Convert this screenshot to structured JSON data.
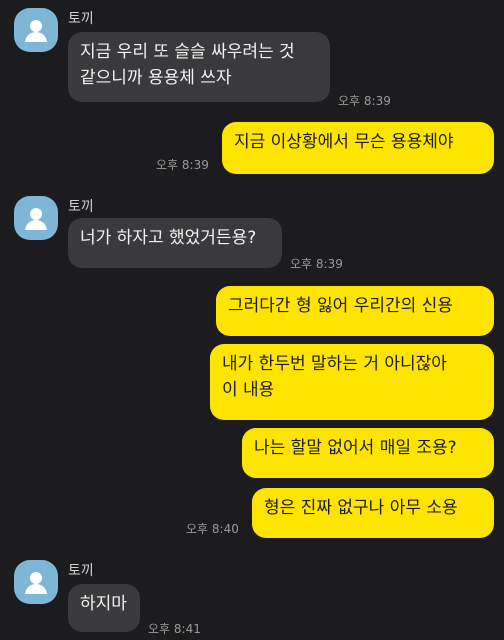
{
  "messages": [
    {
      "sender": "토끼",
      "text": "지금 우리 또 슬슬 싸우려는 것\n같으니까 용용체 쓰자",
      "time": "오후 8:39"
    },
    {
      "text": "지금 이상황에서 무슨 용용체야",
      "time": "오후 8:39"
    },
    {
      "sender": "토끼",
      "text": "너가 하자고 했었거든용?",
      "time": "오후 8:39"
    },
    {
      "text": "그러다간 형 잃어 우리간의 신용"
    },
    {
      "text": "내가 한두번 말하는 거 아니잖아\n이 내용"
    },
    {
      "text": "나는 할말 없어서 매일 조용?"
    },
    {
      "text": "형은 진짜 없구나 아무 소용",
      "time": "오후 8:40"
    },
    {
      "sender": "토끼",
      "text": "하지마",
      "time": "오후 8:41"
    }
  ],
  "colors": {
    "background": "#1c1c1e",
    "incoming_bubble": "#3a3a3c",
    "outgoing_bubble": "#fee500",
    "avatar": "#7fb6d6"
  },
  "icons": {
    "avatar": "default-profile-icon"
  }
}
